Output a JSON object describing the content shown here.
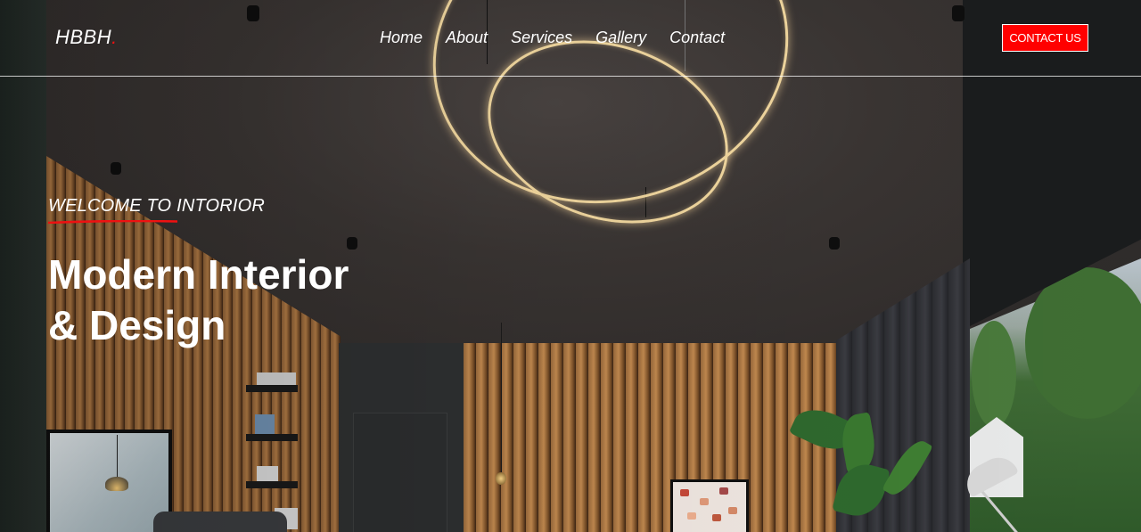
{
  "header": {
    "brand": "HBBH",
    "brand_dot": ".",
    "nav": [
      "Home",
      "About",
      "Services",
      "Gallery",
      "Contact"
    ],
    "cta": "CONTACT US"
  },
  "hero": {
    "eyebrow": "WELCOME TO INTORIOR",
    "headline_line1": "Modern Interior",
    "headline_line2": "& Design"
  },
  "colors": {
    "accent": "#ff0000",
    "text": "#ffffff"
  }
}
